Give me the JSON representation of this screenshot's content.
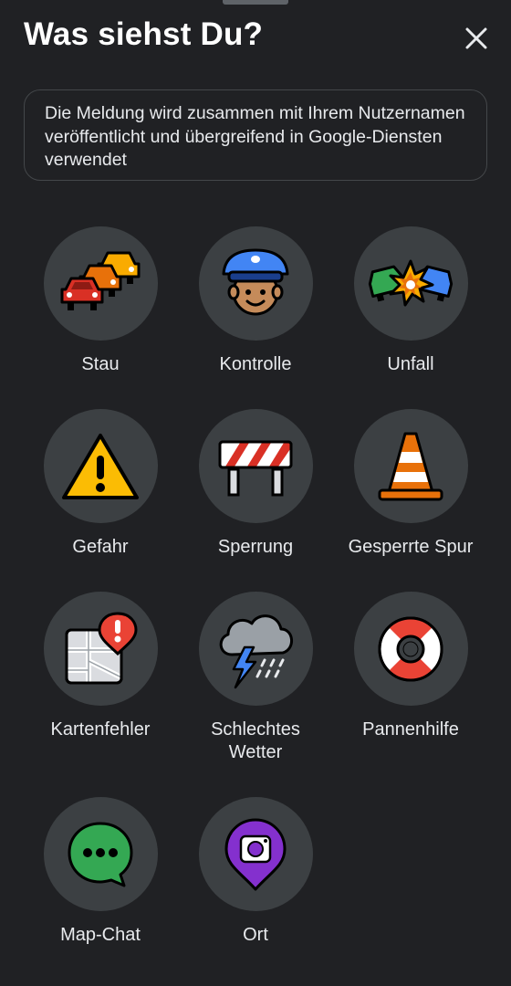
{
  "header": {
    "title": "Was siehst Du?",
    "close_icon": "close-icon"
  },
  "notice": {
    "text": "Die Meldung wird zusammen mit Ihrem Nutzernamen veröffentlicht und übergreifend in Google-Diensten verwendet"
  },
  "reports": [
    {
      "label": "Stau",
      "icon": "traffic-jam-icon"
    },
    {
      "label": "Kontrolle",
      "icon": "police-icon"
    },
    {
      "label": "Unfall",
      "icon": "crash-icon"
    },
    {
      "label": "Gefahr",
      "icon": "hazard-icon"
    },
    {
      "label": "Sperrung",
      "icon": "road-closure-icon"
    },
    {
      "label": "Gesperrte Spur",
      "icon": "traffic-cone-icon"
    },
    {
      "label": "Kartenfehler",
      "icon": "map-error-icon"
    },
    {
      "label": "Schlechtes\nWetter",
      "icon": "bad-weather-icon"
    },
    {
      "label": "Pannenhilfe",
      "icon": "lifebuoy-icon"
    },
    {
      "label": "Map-Chat",
      "icon": "chat-icon"
    },
    {
      "label": "Ort",
      "icon": "place-icon"
    }
  ],
  "colors": {
    "background": "#202124",
    "tile_circle": "#3c4043",
    "text": "#e8eaed"
  }
}
